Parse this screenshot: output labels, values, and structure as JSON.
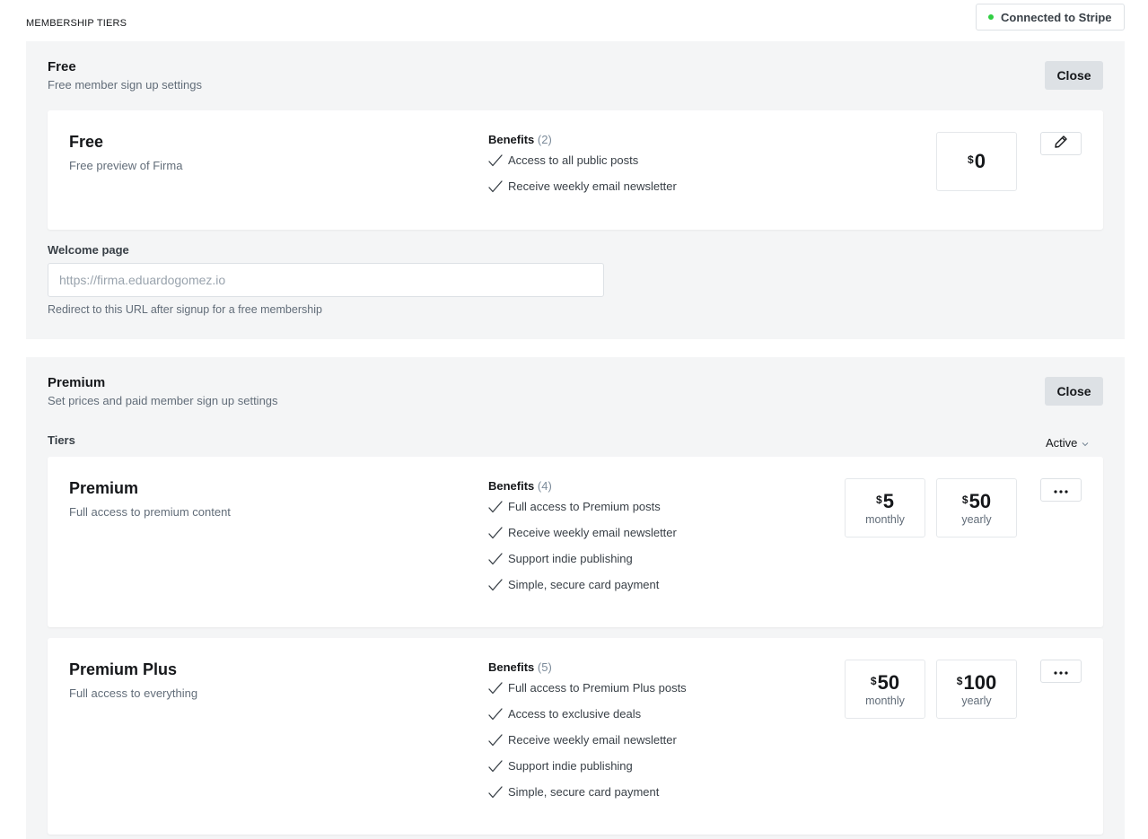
{
  "page": {
    "heading": "MEMBERSHIP TIERS"
  },
  "stripe": {
    "status": "Connected to Stripe",
    "dot_color": "#30cf43"
  },
  "free_section": {
    "title": "Free",
    "description": "Free member sign up settings",
    "close_label": "Close",
    "tier": {
      "name": "Free",
      "description": "Free preview of Firma",
      "benefits_label": "Benefits",
      "benefits_count": "(2)",
      "benefits": [
        "Access to all public posts",
        "Receive weekly email newsletter"
      ],
      "price": {
        "currency": "$",
        "amount": "0"
      },
      "action_icon": "pencil-icon"
    },
    "welcome_page": {
      "label": "Welcome page",
      "placeholder": "https://firma.eduardogomez.io",
      "value": "",
      "help": "Redirect to this URL after signup for a free membership"
    }
  },
  "premium_section": {
    "title": "Premium",
    "description": "Set prices and paid member sign up settings",
    "close_label": "Close",
    "tiers_label": "Tiers",
    "filter": {
      "selected": "Active",
      "icon": "chevron-down-icon"
    },
    "tiers": [
      {
        "name": "Premium",
        "description": "Full access to premium content",
        "benefits_label": "Benefits",
        "benefits_count": "(4)",
        "benefits": [
          "Full access to Premium posts",
          "Receive weekly email newsletter",
          "Support indie publishing",
          "Simple, secure card payment"
        ],
        "monthly": {
          "currency": "$",
          "amount": "5",
          "period": "monthly"
        },
        "yearly": {
          "currency": "$",
          "amount": "50",
          "period": "yearly"
        },
        "action_icon": "more-icon"
      },
      {
        "name": "Premium Plus",
        "description": "Full access to everything",
        "benefits_label": "Benefits",
        "benefits_count": "(5)",
        "benefits": [
          "Full access to Premium Plus posts",
          "Access to exclusive deals",
          "Receive weekly email newsletter",
          "Support indie publishing",
          "Simple, secure card payment"
        ],
        "monthly": {
          "currency": "$",
          "amount": "50",
          "period": "monthly"
        },
        "yearly": {
          "currency": "$",
          "amount": "100",
          "period": "yearly"
        },
        "action_icon": "more-icon"
      }
    ]
  }
}
